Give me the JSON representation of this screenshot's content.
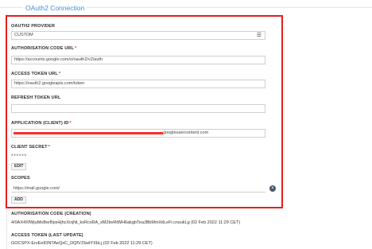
{
  "section": {
    "title": "OAuth2 Connection"
  },
  "provider": {
    "label": "OAUTH2 PROVIDER",
    "value": "CUSTOM"
  },
  "auth_code_url": {
    "label": "AUTHORISATION CODE URL",
    "value": "https://accounts.google.com/o/oauth2/v2/auth"
  },
  "access_token_url": {
    "label": "ACCESS TOKEN URL",
    "value": "https://oauth2.googleapis.com/token"
  },
  "refresh_token_url": {
    "label": "REFRESH TOKEN URL",
    "value": ""
  },
  "application_id": {
    "label": "APPLICATION (CLIENT) ID",
    "value_visible": "googleusercontent.com"
  },
  "client_secret": {
    "label": "CLIENT SECRET",
    "masked_value": "******",
    "edit_label": "EDIT"
  },
  "scopes": {
    "label": "SCOPES",
    "items": [
      "https://mail.google.com/"
    ],
    "add_label": "ADD"
  },
  "auth_code_creation": {
    "label": "AUTHORISATION CODE (CREATION)",
    "value": "4/0AX4XfWjuMoBerBpxHjhcXrqNt_kxRcsRA_xM2bvRtWH6akgbTeaJBbMmXitLeFi.cnsukLg (02 Feb 2022 11:29 CET)"
  },
  "access_token_update": {
    "label": "ACCESS TOKEN (LAST UPDATE)",
    "value": "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 (02 Feb 2022 11:29 CET)"
  },
  "colors": {
    "accent": "#3b8ed8",
    "highlight_border": "#e41f1f",
    "required": "#e41f1f"
  },
  "icons": {
    "select_caret": "list-caret-icon",
    "remove_scope": "remove-circle-icon"
  }
}
